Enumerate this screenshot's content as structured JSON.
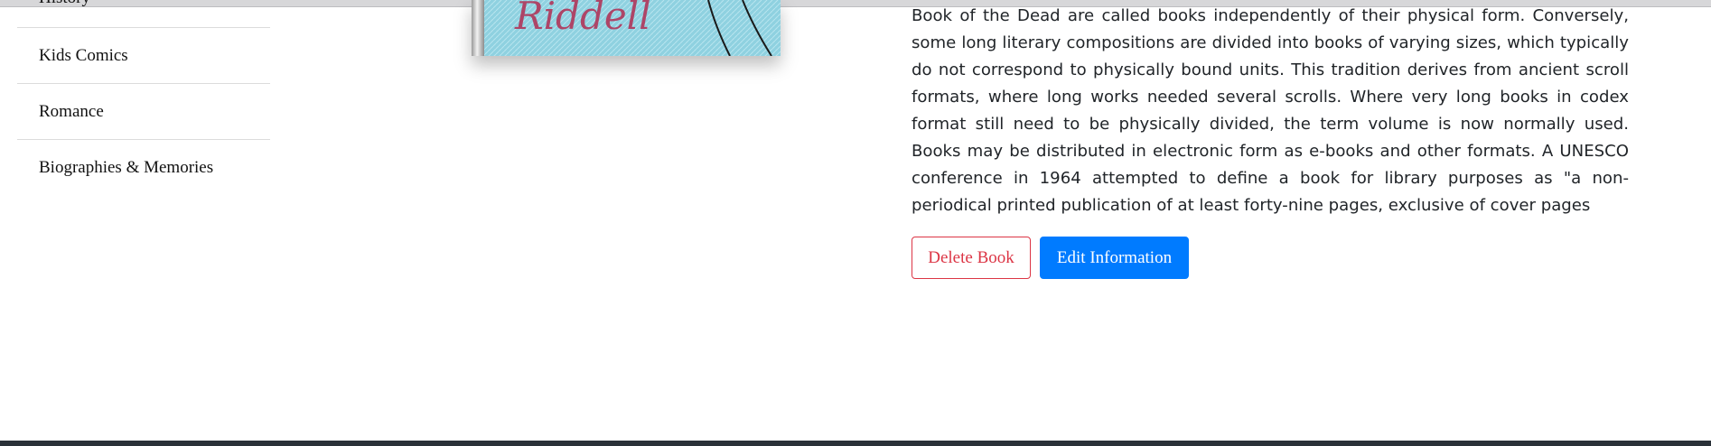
{
  "sidebar": {
    "items": [
      {
        "label": "History"
      },
      {
        "label": "Kids Comics"
      },
      {
        "label": "Romance"
      },
      {
        "label": "Biographies & Memories"
      }
    ]
  },
  "book": {
    "cover_text": "Riddell",
    "description": "Book of the Dead are called books independently of their physical form. Conversely, some long literary compositions are divided into books of varying sizes, which typically do not correspond to physically bound units. This tradition derives from ancient scroll formats, where long works needed several scrolls. Where very long books in codex format still need to be physically divided, the term volume is now normally used. Books may be distributed in electronic form as e-books and other formats. A UNESCO conference in 1964 attempted to define a book for library purposes as \"a non-periodical printed publication of at least forty-nine pages, exclusive of cover pages"
  },
  "actions": {
    "delete_label": "Delete Book",
    "edit_label": "Edit Information"
  },
  "colors": {
    "danger": "#dc3545",
    "primary": "#007bff",
    "footer": "#2a3138"
  }
}
